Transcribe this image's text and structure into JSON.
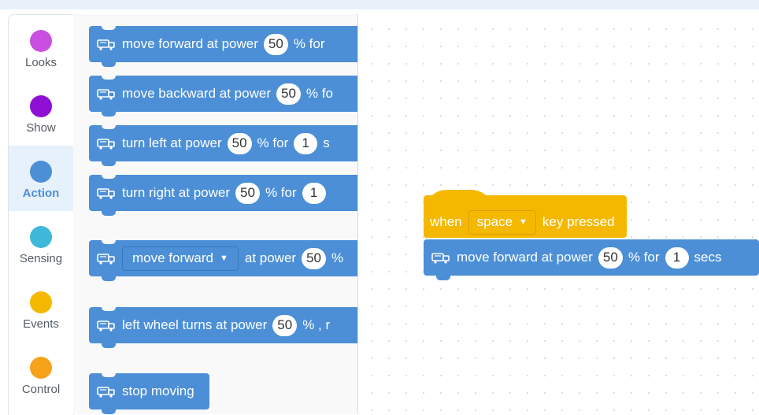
{
  "categories": [
    {
      "label": "Looks",
      "color": "#c94fe0",
      "selected": false
    },
    {
      "label": "Show",
      "color": "#8f0fd4",
      "selected": false
    },
    {
      "label": "Action",
      "color": "#4c8fd6",
      "selected": true
    },
    {
      "label": "Sensing",
      "color": "#3fb8d9",
      "selected": false
    },
    {
      "label": "Events",
      "color": "#f5b800",
      "selected": false
    },
    {
      "label": "Control",
      "color": "#f7a21b",
      "selected": false
    }
  ],
  "palette": {
    "move_forward": {
      "text": "move forward at power",
      "power": "50",
      "tail": "% for"
    },
    "move_backward": {
      "text": "move backward at power",
      "power": "50",
      "tail": "% fo"
    },
    "turn_left": {
      "text": "turn left at power",
      "power": "50",
      "tail": "% for",
      "secs": "1",
      "tail2": "s"
    },
    "turn_right": {
      "text": "turn right at power",
      "power": "50",
      "tail": "% for",
      "secs": "1"
    },
    "move_dropdown": {
      "option": "move forward",
      "text": "at power",
      "power": "50",
      "tail": "%"
    },
    "left_wheel": {
      "text": "left wheel turns at power",
      "power": "50",
      "tail": "% , r"
    },
    "stop": {
      "text": "stop moving"
    }
  },
  "canvas": {
    "hat": {
      "when": "when",
      "key": "space",
      "tail": "key pressed"
    },
    "stack": {
      "text": "move forward at power",
      "power": "50",
      "mid": "% for",
      "secs": "1",
      "tail": "secs"
    }
  },
  "colors": {
    "action": "#4c8fd6",
    "events": "#f5b800"
  }
}
